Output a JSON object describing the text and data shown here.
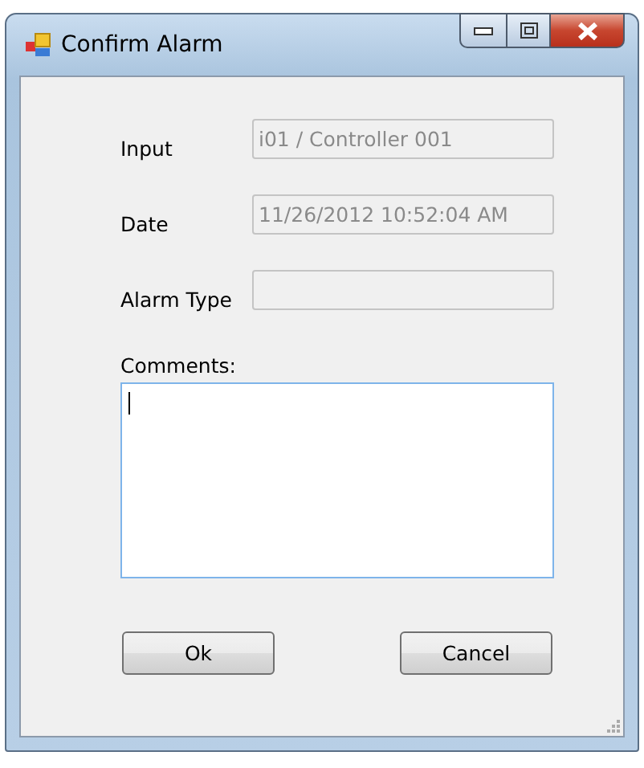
{
  "window": {
    "title": "Confirm Alarm"
  },
  "fields": [
    {
      "label": "Input",
      "value": "i01 / Controller 001",
      "disabled": true
    },
    {
      "label": "Date",
      "value": "11/26/2012 10:52:04 AM",
      "disabled": true
    },
    {
      "label": "Alarm Type",
      "disabled": true
    }
  ],
  "comments": {
    "label": "Comments:",
    "focused": true
  },
  "buttons": [
    "Ok",
    "Cancel"
  ]
}
